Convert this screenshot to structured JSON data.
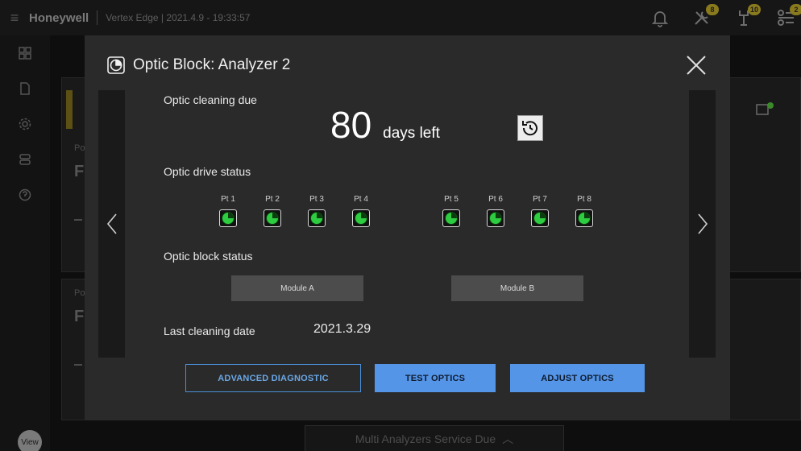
{
  "app": {
    "brand": "Honeywell",
    "subtitle": "Vertex Edge | 2021.4.9 - 19:33:57",
    "badges": {
      "tools": "8",
      "service": "10",
      "list": "2"
    },
    "view_label": "View",
    "bottom_bar_text": "Multi Analyzers Service Due",
    "bg_card_texts": [
      "Po",
      "F",
      "Po",
      "F"
    ]
  },
  "icons": {
    "menu": "hamburger-icon",
    "bell": "bell-icon",
    "tools": "tools-icon",
    "service": "service-icon",
    "list": "list-settings-icon",
    "optic": "optic-block-icon",
    "close": "close-icon",
    "history": "history-icon",
    "prev": "chevron-left-icon",
    "next": "chevron-right-icon",
    "pt_status": "status-ok-icon"
  },
  "colors": {
    "accent_blue": "#5595e8",
    "status_green": "#2ecc40",
    "modal_bg": "#2a2a2a"
  },
  "modal": {
    "title": "Optic Block: Analyzer 2",
    "cleaning_due_label": "Optic cleaning due",
    "days_value": "80",
    "days_unit": "days left",
    "drive_status_label": "Optic drive status",
    "points": [
      {
        "label": "Pt 1",
        "status": "ok"
      },
      {
        "label": "Pt 2",
        "status": "ok"
      },
      {
        "label": "Pt 3",
        "status": "ok"
      },
      {
        "label": "Pt 4",
        "status": "ok"
      },
      {
        "label": "Pt 5",
        "status": "ok"
      },
      {
        "label": "Pt 6",
        "status": "ok"
      },
      {
        "label": "Pt 7",
        "status": "ok"
      },
      {
        "label": "Pt 8",
        "status": "ok"
      }
    ],
    "block_status_label": "Optic block status",
    "module_a": "Module A",
    "module_b": "Module B",
    "last_cleaning_label": "Last cleaning date",
    "last_cleaning_value": "2021.3.29",
    "btn_advanced": "ADVANCED DIAGNOSTIC",
    "btn_test": "TEST OPTICS",
    "btn_adjust": "ADJUST OPTICS"
  }
}
